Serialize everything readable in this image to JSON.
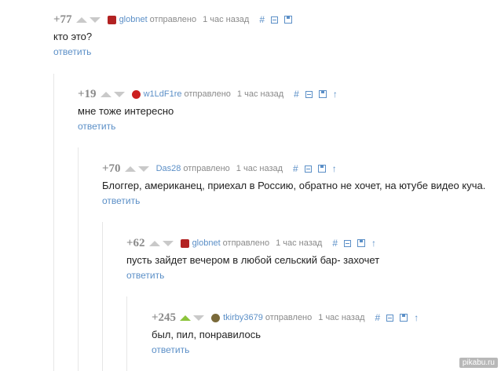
{
  "comments": [
    {
      "rating": "+77",
      "author": "globnet",
      "sent": "отправлено",
      "time": "1 час назад",
      "text": "кто это?",
      "reply": "ответить",
      "avatar_color": "#b22222",
      "up_active": false
    },
    {
      "rating": "+19",
      "author": "w1LdF1re",
      "sent": "отправлено",
      "time": "1 час назад",
      "text": "мне тоже интересно",
      "reply": "ответить",
      "avatar_color": "#cc2020",
      "up_active": false
    },
    {
      "rating": "+70",
      "author": "Das28",
      "sent": "отправлено",
      "time": "1 час назад",
      "text": "Блоггер, американец, приехал в Россию, обратно не хочет, на ютубе видео куча.",
      "reply": "ответить",
      "avatar_color": "",
      "up_active": false
    },
    {
      "rating": "+62",
      "author": "globnet",
      "sent": "отправлено",
      "time": "1 час назад",
      "text": "пусть зайдет вечером в любой сельский бар- захочет",
      "reply": "ответить",
      "avatar_color": "#b22222",
      "up_active": false
    },
    {
      "rating": "+245",
      "author": "tkirby3679",
      "sent": "отправлено",
      "time": "1 час назад",
      "text": "был, пил, понравилось",
      "reply": "ответить",
      "avatar_color": "#7a6a3a",
      "up_active": true
    }
  ],
  "tools": {
    "hash": "#",
    "up": "↑"
  },
  "watermark": "pikabu.ru",
  "colors": {
    "link": "#5b8fc7",
    "rating": "#8a8a8a",
    "vote_active": "#8cc43c"
  }
}
